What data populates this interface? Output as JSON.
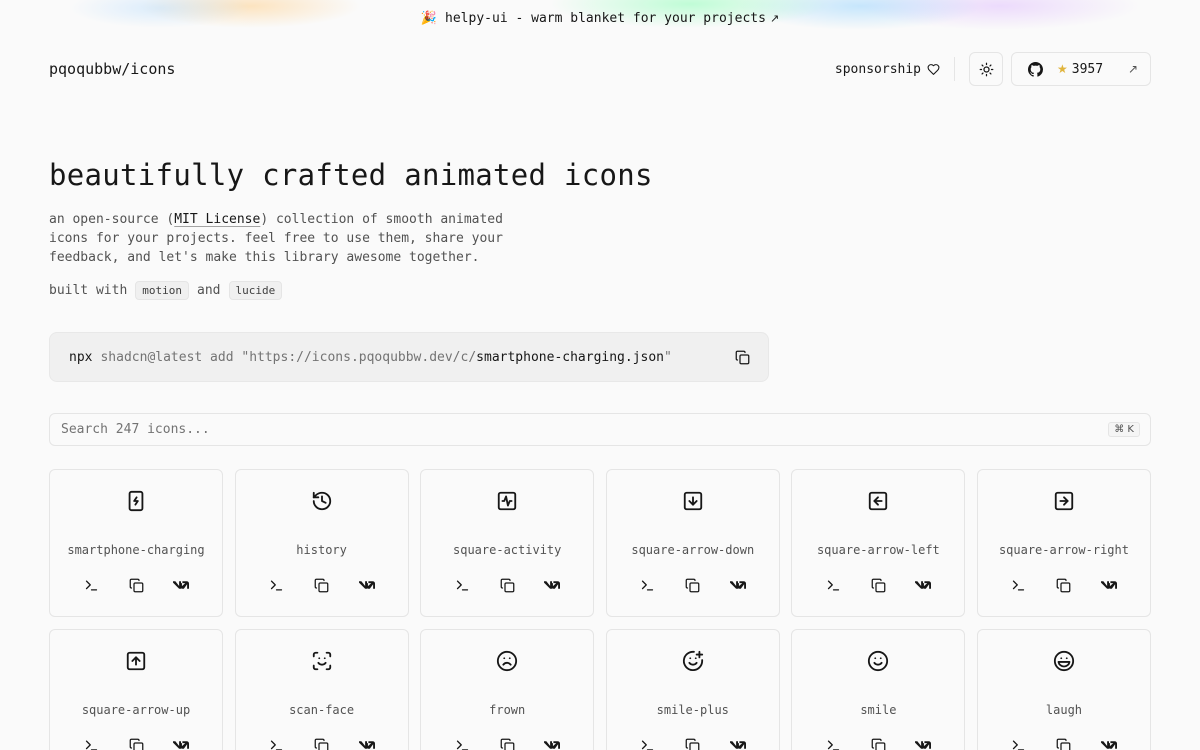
{
  "banner": {
    "emoji": "🎉",
    "text": "helpy-ui - warm blanket for your projects",
    "arrow": "↗"
  },
  "header": {
    "brand": "pqoqubbw/icons",
    "sponsor_label": "sponsorship",
    "github_stars": "3957"
  },
  "hero": {
    "title": "beautifully crafted animated icons",
    "desc_prefix": "an open-source (",
    "license": "MIT License",
    "desc_suffix": ") collection of smooth animated icons for your projects. feel free to use them, share your feedback, and let's make this library awesome together.",
    "built_with": "built with",
    "lib1": "motion",
    "and": "and",
    "lib2": "lucide"
  },
  "command": {
    "npx": "npx",
    "mid": "shadcn@latest add \"https://icons.pqoqubbw.dev/c/",
    "file": "smartphone-charging.json",
    "end": "\""
  },
  "search": {
    "placeholder": "Search 247 icons...",
    "shortcut": "⌘ K"
  },
  "icons": [
    {
      "name": "smartphone-charging",
      "icon": "smartphone-charging-icon"
    },
    {
      "name": "history",
      "icon": "history-icon"
    },
    {
      "name": "square-activity",
      "icon": "square-activity-icon"
    },
    {
      "name": "square-arrow-down",
      "icon": "square-arrow-down-icon"
    },
    {
      "name": "square-arrow-left",
      "icon": "square-arrow-left-icon"
    },
    {
      "name": "square-arrow-right",
      "icon": "square-arrow-right-icon"
    },
    {
      "name": "square-arrow-up",
      "icon": "square-arrow-up-icon"
    },
    {
      "name": "scan-face",
      "icon": "scan-face-icon"
    },
    {
      "name": "frown",
      "icon": "frown-icon"
    },
    {
      "name": "smile-plus",
      "icon": "smile-plus-icon"
    },
    {
      "name": "smile",
      "icon": "smile-icon"
    },
    {
      "name": "laugh",
      "icon": "laugh-icon"
    }
  ],
  "colors": {
    "accent_star": "#e0b43c",
    "border": "#e5e5e5",
    "background": "#fafafa"
  }
}
